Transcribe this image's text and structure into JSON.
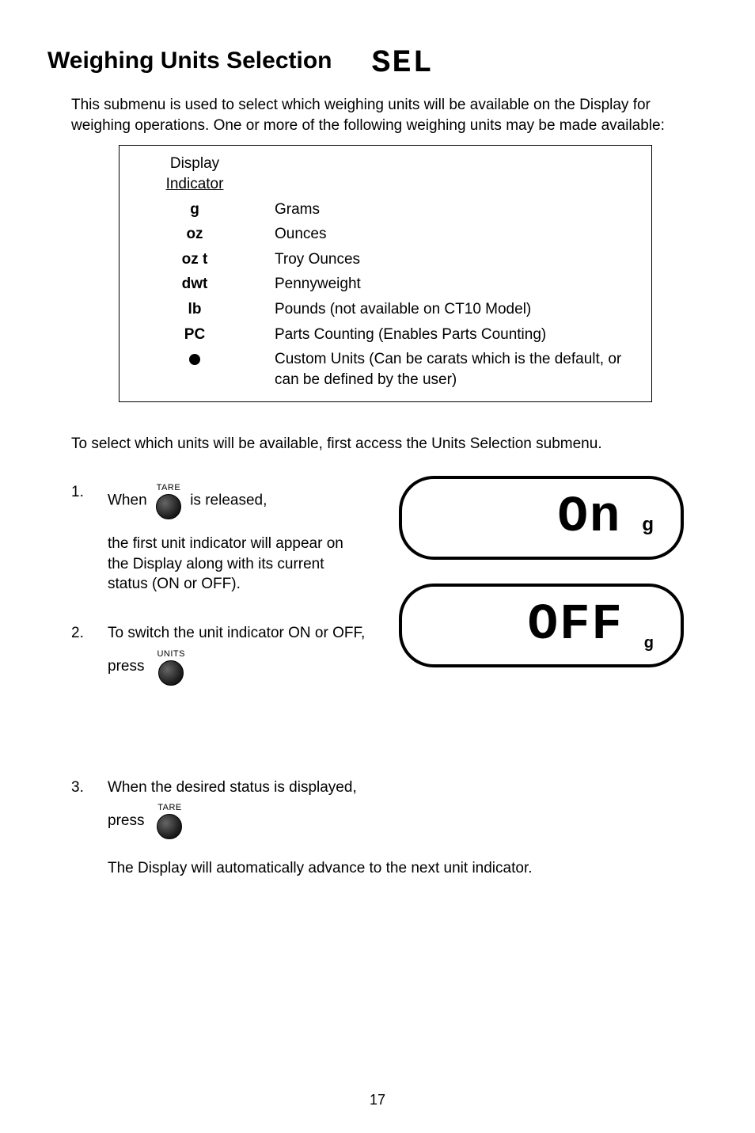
{
  "heading": {
    "title": "Weighing Units Selection",
    "code": "SEL"
  },
  "intro": "This submenu is used to select which weighing units will be available on the Display for weighing operations. One or more of the following weighing units may be made available:",
  "table": {
    "header": {
      "line1": "Display",
      "line2": "Indicator"
    },
    "rows": [
      {
        "ind": "g",
        "desc": "Grams"
      },
      {
        "ind": "oz",
        "desc": "Ounces"
      },
      {
        "ind": "oz t",
        "desc": "Troy Ounces"
      },
      {
        "ind": "dwt",
        "desc": "Pennyweight"
      },
      {
        "ind": "lb",
        "desc": "Pounds (not available on CT10 Model)"
      },
      {
        "ind": "PC",
        "desc": "Parts Counting (Enables Parts Counting)"
      },
      {
        "ind": "●",
        "desc": "Custom Units (Can be carats which is the default, or can be defined by the user)"
      }
    ]
  },
  "midpara": "To select which units will be available, first access the Units Selection submenu.",
  "steps": {
    "s1": {
      "num": "1.",
      "pre": "When",
      "btn": "TARE",
      "post": "is released,",
      "sub": "the first unit indicator will appear on the Display along with its current status (ON or OFF)."
    },
    "s2": {
      "num": "2.",
      "line1": "To switch the unit indicator ON or OFF,",
      "presslabel": "press",
      "btn": "UNITS"
    },
    "s3": {
      "num": "3.",
      "line1": "When the desired status is displayed,",
      "presslabel": "press",
      "btn": "TARE",
      "sub": "The Display will automatically advance to the next unit indicator."
    }
  },
  "displays": {
    "d1": {
      "big": "On",
      "small": "g"
    },
    "d2": {
      "big": "OFF",
      "small": "g"
    }
  },
  "pagenum": "17"
}
